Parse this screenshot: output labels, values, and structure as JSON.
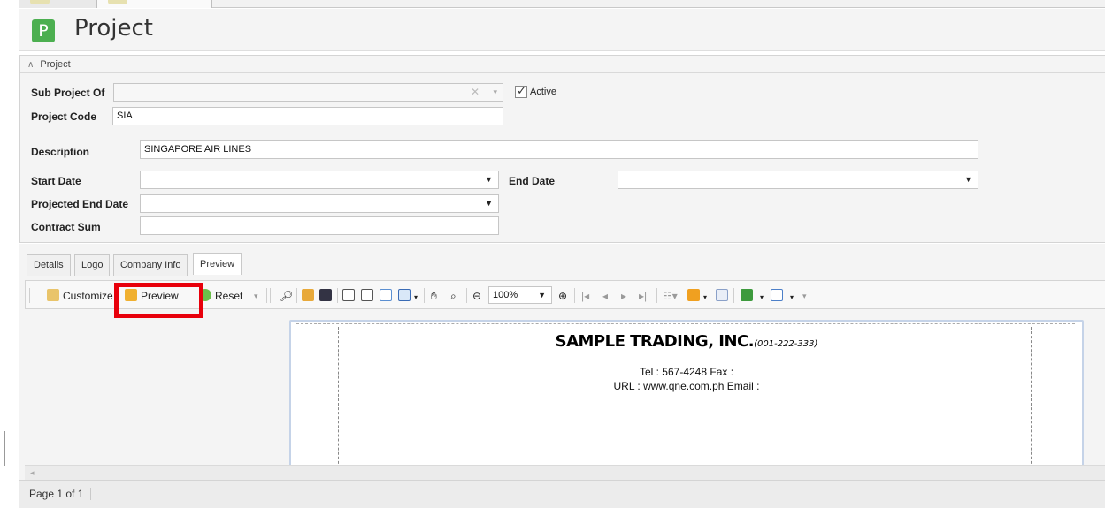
{
  "header": {
    "logo_letter": "P",
    "title": "Project"
  },
  "group": {
    "title": "Project"
  },
  "form": {
    "sub_project_of": {
      "label": "Sub Project Of",
      "value": ""
    },
    "active": {
      "label": "Active",
      "checked": true
    },
    "project_code": {
      "label": "Project Code",
      "value": "SIA"
    },
    "description": {
      "label": "Description",
      "value": "SINGAPORE AIR LINES"
    },
    "start_date": {
      "label": "Start Date",
      "value": ""
    },
    "end_date": {
      "label": "End Date",
      "value": ""
    },
    "projected_end_date": {
      "label": "Projected End Date",
      "value": ""
    },
    "contract_sum": {
      "label": "Contract Sum",
      "value": ""
    }
  },
  "tabs": [
    {
      "label": "Details"
    },
    {
      "label": "Logo"
    },
    {
      "label": "Company Info"
    },
    {
      "label": "Preview",
      "active": true
    }
  ],
  "toolbar": {
    "customize_label": "Customize",
    "preview_label": "Preview",
    "reset_label": "Reset",
    "zoom_value": "100%"
  },
  "report": {
    "company_name": "SAMPLE TRADING, INC.",
    "company_reg": "(001-222-333)",
    "tel_line": "Tel : 567-4248  Fax :",
    "url_line": "URL  : www.qne.com.ph     Email :"
  },
  "status": {
    "page_text": "Page 1 of 1"
  },
  "colors": {
    "highlight": "#e8000b",
    "logo_green": "#4caf50"
  }
}
